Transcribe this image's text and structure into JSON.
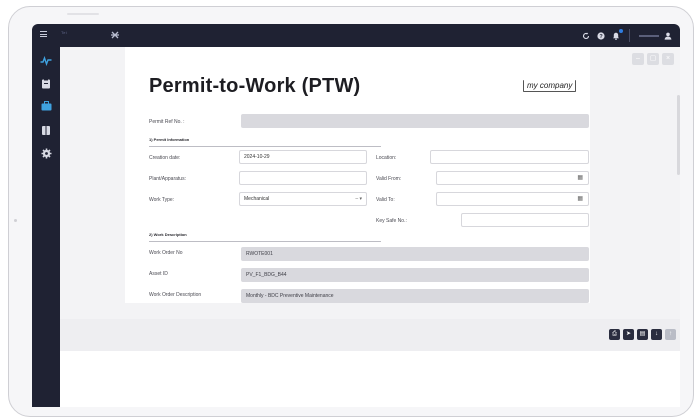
{
  "topbar": {
    "brand_line1": "Tei",
    "brand_line2": "",
    "icons": [
      "menu-icon",
      "app-switch-icon",
      "refresh-icon",
      "help-icon",
      "bell-icon",
      "user-icon"
    ]
  },
  "sidebar": {
    "items": [
      {
        "icon": "pulse-icon",
        "active": true
      },
      {
        "icon": "clipboard-icon",
        "active": false
      },
      {
        "icon": "briefcase-icon",
        "active": false
      },
      {
        "icon": "book-icon",
        "active": false
      },
      {
        "icon": "gear-icon",
        "active": false
      }
    ]
  },
  "document": {
    "title": "Permit-to-Work (PTW)",
    "logo_text": "my company",
    "permit_ref_label": "Permit Ref No. :",
    "permit_ref_value": "",
    "section1_title": "1) Permit Information",
    "creation_date_label": "Creation date:",
    "creation_date_value": "2024-10-29",
    "location_label": "Location:",
    "location_value": "",
    "plant_label": "Plant/Apparatus:",
    "plant_value": "",
    "valid_from_label": "Valid From:",
    "valid_from_value": "",
    "work_type_label": "Work Type:",
    "work_type_value": "Mechanical",
    "valid_to_label": "Valid To:",
    "valid_to_value": "",
    "key_safe_label": "Key Safe No.:",
    "key_safe_value": "",
    "section2_title": "2) Work Description",
    "work_order_no_label": "Work Order No",
    "work_order_no_value": "RWOTE001",
    "asset_id_label": "Asset ID",
    "asset_id_value": "PV_F1_BDG_B44",
    "work_order_desc_label": "Work Order Description",
    "work_order_desc_value": "Monthly - BDC Preventive Maintenance"
  },
  "colors": {
    "topbar": "#1f2233",
    "sidebar_active": "#3fa2e0",
    "readonly_field": "#d9d9de",
    "action_button": "#2a2d3f"
  }
}
